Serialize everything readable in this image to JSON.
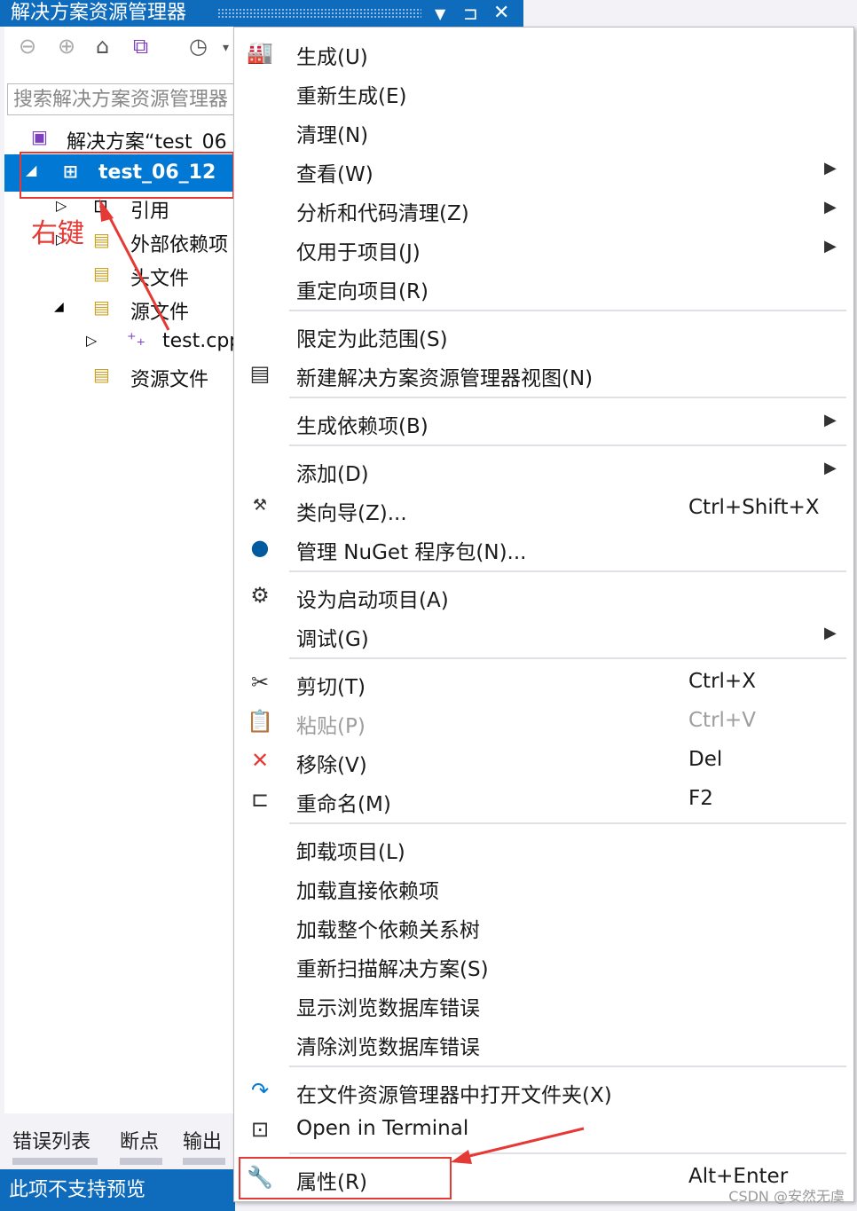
{
  "solution_explorer": {
    "title": "解决方案资源管理器",
    "title_controls": [
      "▼",
      "⊐",
      "✕"
    ],
    "search_placeholder": "搜索解决方案资源管理器",
    "tree": {
      "solution": "解决方案“test_06",
      "project": "test_06_12",
      "items": [
        "引用",
        "外部依赖项",
        "头文件",
        "源文件",
        "test.cpp",
        "资源文件"
      ]
    },
    "annotation": "右键"
  },
  "bottom_tabs": [
    "错误列表",
    "断点",
    "输出"
  ],
  "status": "此项不支持预览",
  "context_menu": {
    "items": [
      {
        "label": "生成(U)",
        "shortcut": "",
        "submenu": false
      },
      {
        "label": "重新生成(E)",
        "shortcut": "",
        "submenu": false
      },
      {
        "label": "清理(N)",
        "shortcut": "",
        "submenu": false
      },
      {
        "label": "查看(W)",
        "shortcut": "",
        "submenu": true
      },
      {
        "label": "分析和代码清理(Z)",
        "shortcut": "",
        "submenu": true
      },
      {
        "label": "仅用于项目(J)",
        "shortcut": "",
        "submenu": true
      },
      {
        "label": "重定向项目(R)",
        "shortcut": "",
        "submenu": false
      },
      {
        "label": "限定为此范围(S)",
        "shortcut": "",
        "submenu": false
      },
      {
        "label": "新建解决方案资源管理器视图(N)",
        "shortcut": "",
        "submenu": false
      },
      {
        "label": "生成依赖项(B)",
        "shortcut": "",
        "submenu": true
      },
      {
        "label": "添加(D)",
        "shortcut": "",
        "submenu": true
      },
      {
        "label": "类向导(Z)...",
        "shortcut": "Ctrl+Shift+X",
        "submenu": false
      },
      {
        "label": "管理 NuGet 程序包(N)...",
        "shortcut": "",
        "submenu": false
      },
      {
        "label": "设为启动项目(A)",
        "shortcut": "",
        "submenu": false
      },
      {
        "label": "调试(G)",
        "shortcut": "",
        "submenu": true
      },
      {
        "label": "剪切(T)",
        "shortcut": "Ctrl+X",
        "submenu": false
      },
      {
        "label": "粘贴(P)",
        "shortcut": "Ctrl+V",
        "submenu": false,
        "disabled": true
      },
      {
        "label": "移除(V)",
        "shortcut": "Del",
        "submenu": false
      },
      {
        "label": "重命名(M)",
        "shortcut": "F2",
        "submenu": false
      },
      {
        "label": "卸载项目(L)",
        "shortcut": "",
        "submenu": false
      },
      {
        "label": "加载直接依赖项",
        "shortcut": "",
        "submenu": false
      },
      {
        "label": "加载整个依赖关系树",
        "shortcut": "",
        "submenu": false
      },
      {
        "label": "重新扫描解决方案(S)",
        "shortcut": "",
        "submenu": false
      },
      {
        "label": "显示浏览数据库错误",
        "shortcut": "",
        "submenu": false
      },
      {
        "label": "清除浏览数据库错误",
        "shortcut": "",
        "submenu": false
      },
      {
        "label": "在文件资源管理器中打开文件夹(X)",
        "shortcut": "",
        "submenu": false
      },
      {
        "label": "Open in Terminal",
        "shortcut": "",
        "submenu": false
      },
      {
        "label": "属性(R)",
        "shortcut": "Alt+Enter",
        "submenu": false
      }
    ]
  },
  "watermark": "CSDN @安然无虞",
  "colors": {
    "accent": "#0f6cbd",
    "selection": "#0078d4",
    "annotation": "#e53935"
  }
}
